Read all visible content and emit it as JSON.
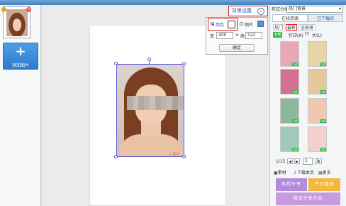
{
  "left": {
    "add_photo_label": "添加图片",
    "thumb_badge": "×"
  },
  "toolbar": {
    "bg_setting_label": "背景设置",
    "chevron": "⌄"
  },
  "popup": {
    "color_label": "颜色",
    "image_label": "图片",
    "width_label": "宽",
    "width_value": "400",
    "height_label": "高",
    "height_value": "522",
    "confirm_label": "确定"
  },
  "photo": {
    "mark": "⊙ 图片"
  },
  "sidebar": {
    "style_label": "样式分类",
    "style_value": "热门背景",
    "tabs": [
      "在线资源",
      "已下载的"
    ],
    "subtabs": [
      "热门",
      "最新",
      "全部排行"
    ],
    "filter_badge": "全部",
    "filter_a": "打印(A)",
    "filter_b": "大(L)",
    "pager": {
      "page_text": "1/15",
      "prev": "◀",
      "next": "▶",
      "page_input": "1",
      "go_label": "确"
    },
    "actions": [
      "素材",
      "下载本页",
      "更多"
    ],
    "buttons": [
      "电视分享",
      "今日精选",
      "精选分享作品"
    ],
    "hot_badge": "hot"
  },
  "colors": {
    "frames": [
      "#e9a6b4",
      "#e8d5a5",
      "#d76f8f",
      "#e6c89b",
      "#8eb89a",
      "#f0c7b0",
      "#9fcab8",
      "#f4cfd0"
    ],
    "buttons": [
      "#b58ad8",
      "#f5b73c",
      "#c79ae2"
    ]
  }
}
